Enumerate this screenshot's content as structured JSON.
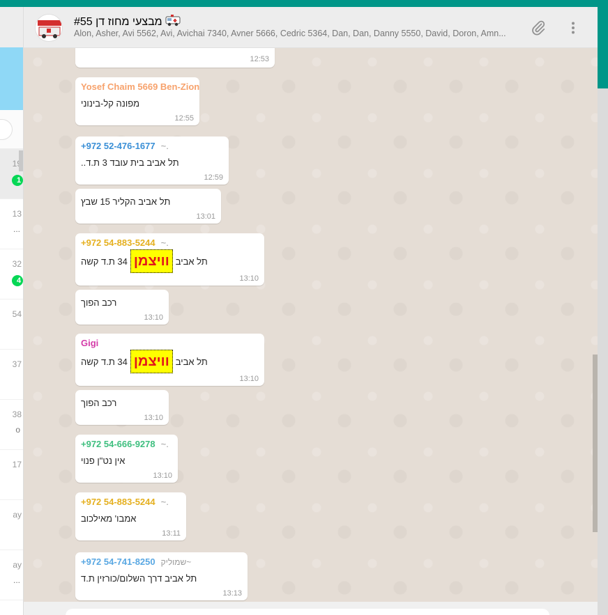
{
  "sidebar": {
    "items": [
      {
        "time": "19",
        "badge": "1",
        "selected": true
      },
      {
        "time": "13",
        "snippet": "..."
      },
      {
        "time": "32",
        "badge": "4"
      },
      {
        "time": "54"
      },
      {
        "time": "37"
      },
      {
        "time": "38",
        "snippet": "o"
      },
      {
        "time": "17"
      },
      {
        "time": "ay"
      },
      {
        "time": "ay",
        "snippet": "..."
      }
    ]
  },
  "header": {
    "title": "מבצעי מחוז דן #55",
    "title_icon": "ambulance-emoji",
    "participants": "Alon, Asher, Avi 5562, Avi, Avichai 7340, Avner 5666, Cedric 5364, Dan, Dan, Danny 5550, David, Doron, Amn...",
    "attach_icon": "paperclip-icon",
    "menu_icon": "more-vertical-icon"
  },
  "messages": [
    {
      "time": "12:53"
    },
    {
      "sender": "Yosef Chaim 5669 Ben-Zion",
      "sender_color": "#f7a26c",
      "text": "מפונה קל-בינוני",
      "time": "12:55"
    },
    {
      "sender": "+972 52-476-1677",
      "alias": "~.",
      "sender_color": "#3a8fd6",
      "text": "תל אביב בית עובד 3 ת.ד..",
      "time": "12:59"
    },
    {
      "text": "תל אביב הקליר 15 שבץ",
      "time": "13:01"
    },
    {
      "sender": "+972 54-883-5244",
      "alias": "~.",
      "sender_color": "#e5b020",
      "text_before": "תל אביב",
      "sticker": "וויצמן",
      "text_after": "34 ת.ד קשה",
      "time": "13:10"
    },
    {
      "text": "רכב הפוך",
      "time": "13:10"
    },
    {
      "sender": "Gigi",
      "sender_color": "#d43ba8",
      "text_before": "תל אביב",
      "sticker": "וויצמן",
      "text_after": "34 ת.ד קשה",
      "time": "13:10"
    },
    {
      "text": "רכב הפוך",
      "time": "13:10"
    },
    {
      "sender": "+972 54-666-9278",
      "alias": "~.",
      "sender_color": "#3fbf7f",
      "text": "אין נט\"ן פנוי",
      "time": "13:10"
    },
    {
      "sender": "+972 54-883-5244",
      "alias": "~.",
      "sender_color": "#e5b020",
      "text": "אמבו' מאילכוב",
      "time": "13:11"
    },
    {
      "sender": "+972 54-741-8250",
      "alias": "~שמוליק",
      "sender_color": "#5aa8e3",
      "text_line1": "תל אביב דרך השלום/כורזין ת.ד",
      "time": "13:13"
    }
  ]
}
